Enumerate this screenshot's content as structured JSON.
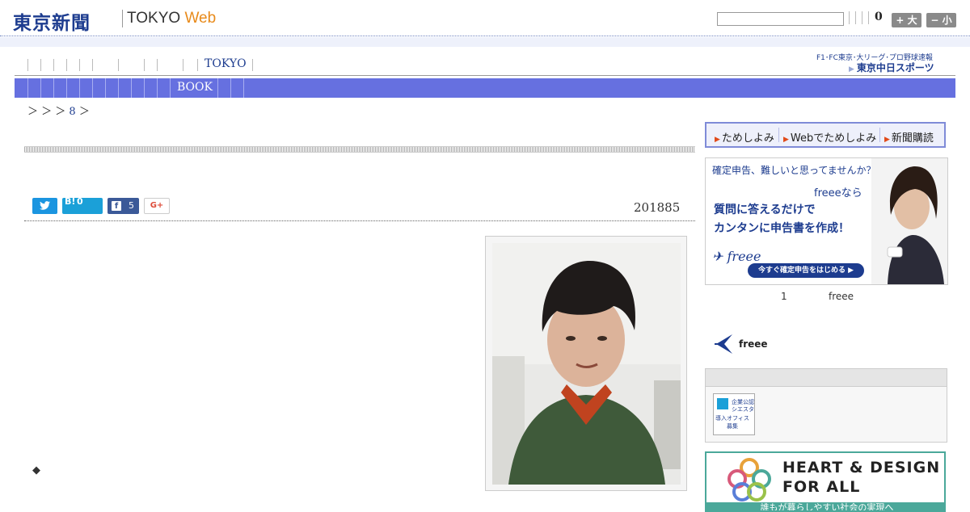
{
  "header": {
    "logo_jp": "東京新聞",
    "logo_en": "TOKYO",
    "logo_en_web": "Web",
    "search_placeholder": "",
    "count": "0",
    "size_up": "+ 大",
    "size_down": "− 小"
  },
  "nav": {
    "primary_label": "TOKYO",
    "secondary_label": "BOOK",
    "sports_top": "F1･FC東京･大リーグ･プロ野球速報",
    "sports_logo": "東京中日スポーツ"
  },
  "breadcrumb": {
    "text1": "＞ ＞ ＞",
    "num": "8",
    "text2": "＞"
  },
  "article": {
    "date": "201885",
    "marker": "◆"
  },
  "share": {
    "twitter_icon": "twitter-bird",
    "hatena_label": "B!",
    "hatena_count": "0",
    "facebook_label": "f",
    "facebook_count": "5",
    "gplus_label": "G+"
  },
  "sidebar": {
    "subscribe": {
      "items": [
        "ためしよみ",
        "Webでためしよみ",
        "新聞購読"
      ]
    },
    "ad": {
      "top": "確定申告、難しいと思ってませんか？",
      "nara": "freeeなら",
      "line1": "質問に答えるだけで",
      "line2": "カンタンに申告書を作成！",
      "logo": "freee",
      "cta": "今すぐ確定申告をはじめる ▶",
      "info": "ⓘ"
    },
    "ad_caption_num": "1",
    "ad_caption_brand": "freee",
    "freee_label": "freee",
    "box_thumb_lines": [
      "企業公認",
      "シエスタ",
      "導入オフィス",
      "募集"
    ],
    "banner2": {
      "line1": "HEART & DESIGN",
      "line2": "FOR ALL",
      "strip": "誰もが暮らしやすい社会の実現へ"
    }
  },
  "colors": {
    "brand_blue": "#1d3c8f",
    "nav_purple": "#6670e0",
    "accent_orange": "#e88a1a",
    "teal": "#4ba89a"
  }
}
